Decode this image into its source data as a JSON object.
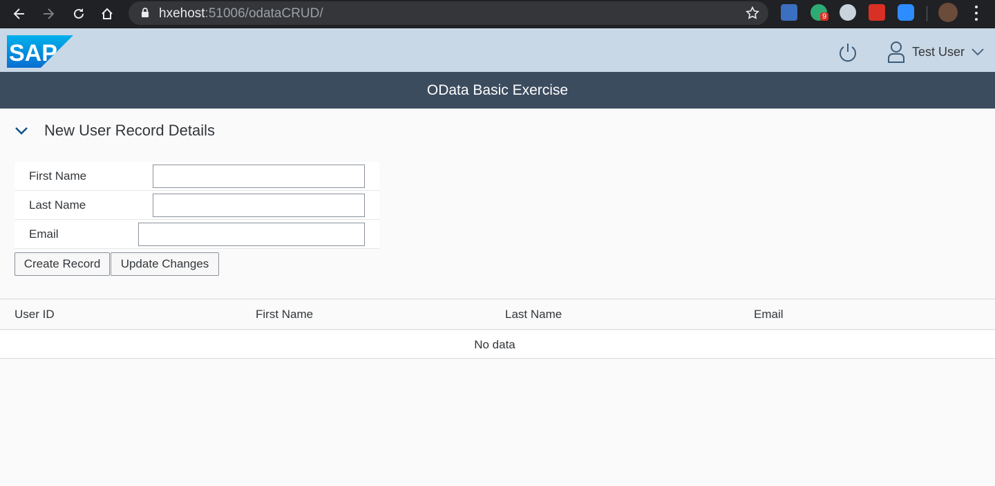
{
  "browser": {
    "url_host": "hxehost",
    "url_rest": ":51006/odataCRUD/",
    "extension_badge": "9",
    "icons": [
      "back-icon",
      "forward-icon",
      "reload-icon",
      "home-icon",
      "lock-icon",
      "bookmark-star-icon",
      "menu-icon"
    ]
  },
  "shell": {
    "logo_text": "SAP",
    "user_name": "Test User"
  },
  "app": {
    "title": "OData Basic Exercise"
  },
  "panel": {
    "title": "New User Record Details",
    "fields": [
      {
        "label": "First Name",
        "value": ""
      },
      {
        "label": "Last Name",
        "value": ""
      },
      {
        "label": "Email",
        "value": ""
      }
    ],
    "buttons": {
      "create": "Create Record",
      "update": "Update Changes"
    }
  },
  "table": {
    "columns": [
      "User ID",
      "First Name",
      "Last Name",
      "Email"
    ],
    "empty_text": "No data"
  },
  "colors": {
    "chrome_bg": "#202124",
    "shell_bg": "#c9d8e6",
    "titlebar_bg": "#3c4c5f",
    "page_bg": "#fafafa"
  }
}
